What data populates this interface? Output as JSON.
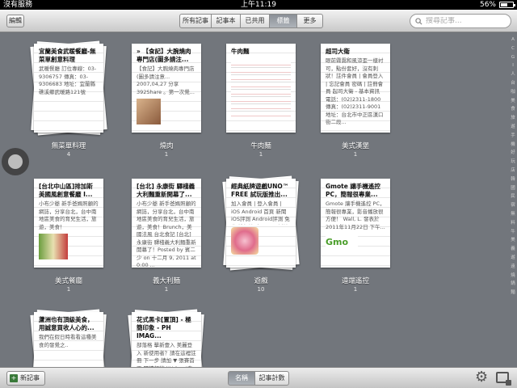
{
  "statusbar": {
    "carrier": "沒有服務",
    "time": "上午11:19",
    "battery": "56%"
  },
  "toolbar": {
    "edit_label": "編輯",
    "segments": [
      "所有記事",
      "記事本",
      "已共用",
      "標籤",
      "更多"
    ],
    "active_segment": "標籤",
    "search_placeholder": "搜尋記事..."
  },
  "items": [
    {
      "title": "宜蘭美食武暖餐廳-無菜單創意料理",
      "body": "武暖餐廳 訂位專線：03-9306757 傳真：03-9306683 地址：宜蘭縣礁溪鄉武暖路121號",
      "label": "無菜單料理",
      "count": "4"
    },
    {
      "title": "» 【食記】大腕燒肉專門店(圖多請注...",
      "body": "【食記】大腕燒肉專門店(圖多請注意... 2007,04,27 分享 392Share 。第一次覺...",
      "label": "燒肉",
      "count": "1"
    },
    {
      "title": "牛肉麵",
      "body": "",
      "label": "牛肉麵",
      "count": "1"
    },
    {
      "title": "超司大衛",
      "body": "眼前霧靄和風涼歪一樣衬可，點份套好，沒有刺 狀！註件會員 | 會員登入 | 忘記會員 密碼 | 註冊會員 起司大衛 - 基本資訊 電話：(02)2311-1800 傳真：(02)2311-9001 地址：台北市中正區漢口街二段...",
      "label": "美式漢堡",
      "count": "1"
    },
    {
      "title": "[台北中山區]排加斯美國風創意餐廳 I...",
      "body": "小布少爺 新手爸媽照顧的網誌，分享台北，台中南地區美食的育兒生活，旅遊，美食！",
      "label": "美式餐廳",
      "count": "1"
    },
    {
      "title": "[台北] 永康街 驛棧義大利麵重新開幕了...",
      "body": "小布少爺 新手爸媽照顧的網誌，分享台北，台中南地區美食的育兒生活，旅遊，美食！Brunch，美國法風 台北食記 [台北] 永康街 驛棧義大利麵重新開幕了！Posted by 賓二少 on 十二月 9, 2011 at 0:00 ...",
      "label": "義大利麵",
      "count": "1"
    },
    {
      "title": "經典紙牌遊戲UNO™ FREE 試玩版推出...",
      "body": "加入會員 | 登入會員 | iOS Android 首頁 新聞 iOS評測 Android評測 免費 排行榜 應用問題 討論區...",
      "label": "遊戲",
      "count": "10"
    },
    {
      "title": "Gmote 讓手機遙控PC，簡報很專業...",
      "body": "Gmote 讓手機遙控 PC，簡報很專業，影音播放很方便！ Wall, L. 發表於 2011年11月22日 下午...",
      "label": "遠端遙控",
      "count": "1"
    },
    {
      "title": "蘆洲也有頂級美食，用誠意買收人心的...",
      "body": "我們在假日時看看這種美食的發覺之..",
      "label": "",
      "count": ""
    },
    {
      "title": "花式黑卡[置頂] - 極簡印象 - PH IMAG...",
      "body": "部落格 擊新壹入 美麗登入 新使用者？請在這裡註冊 下一步 請加 ▼ 張賽首頁 閱讀報稿 i!Yahoo!奇摩 極簡印象...",
      "label": "",
      "count": ""
    }
  ],
  "alphabet": [
    "A",
    "C",
    "G",
    "I",
    "人",
    "台",
    "咖",
    "美",
    "食",
    "旅",
    "遊",
    "手",
    "機",
    "好",
    "玩",
    "店",
    "韓",
    "國",
    "民",
    "宿",
    "無",
    "料",
    "牛",
    "美",
    "義",
    "遊",
    "遠",
    "燒",
    "鍋",
    "麵"
  ],
  "bottombar": {
    "new_label": "新記事",
    "segments": [
      "名稱",
      "記事計數"
    ],
    "active_segment": "名稱"
  },
  "colors": {
    "accent_active": "#8a8f96",
    "content_bg": "#72767c"
  }
}
